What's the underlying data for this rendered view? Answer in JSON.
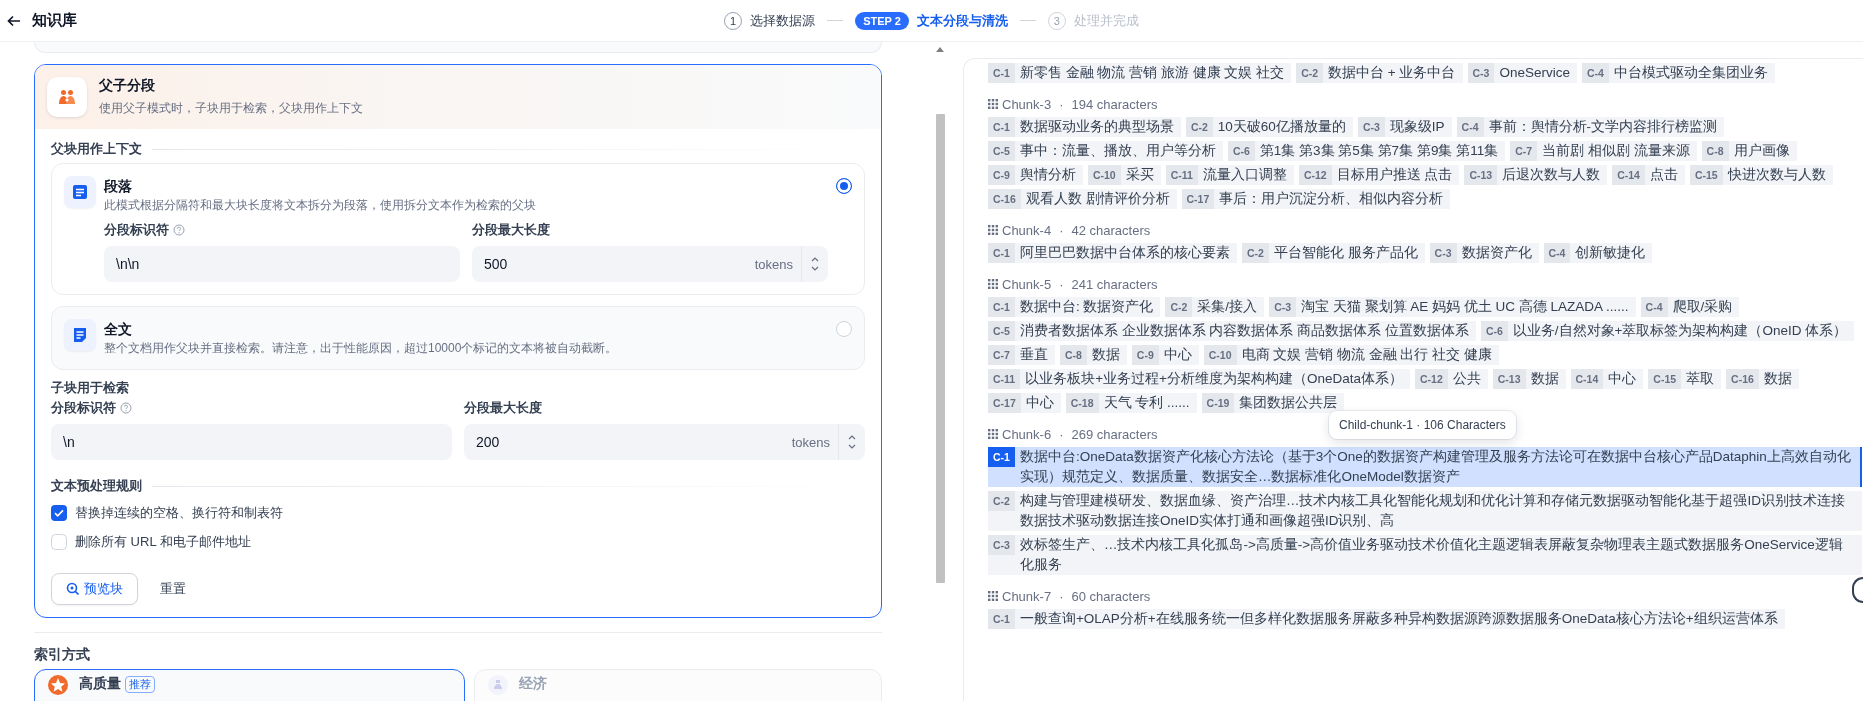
{
  "header": {
    "title": "知识库"
  },
  "steps": [
    {
      "badge": "1",
      "label": "选择数据源",
      "done": true,
      "selected": false
    },
    {
      "badge": "STEP 2",
      "label": "文本分段与清洗",
      "selected": true
    },
    {
      "badge": "3",
      "label": "处理并完成",
      "done": false,
      "selected": false
    }
  ],
  "left": {
    "mode": {
      "title": "父子分段",
      "description": "使用父子模式时，子块用于检索，父块用作上下文",
      "selected": true
    },
    "parent_section": {
      "title": "父块用作上下文",
      "options": [
        {
          "title": "段落",
          "description": "此模式根据分隔符和最大块长度将文本拆分为段落，使用拆分文本作为检索的父块",
          "selected": true,
          "fields": [
            {
              "kind": "separator",
              "label": "分段标识符",
              "value": "\\n\\n"
            },
            {
              "kind": "length",
              "label": "分段最大长度",
              "value": "500",
              "unit": "tokens"
            }
          ]
        },
        {
          "title": "全文",
          "description": "整个文档用作父块并直接检索。请注意，出于性能原因，超过10000个标记的文本将被自动截断。",
          "selected": false
        }
      ]
    },
    "child_section": {
      "title": "子块用于检索",
      "fields": [
        {
          "kind": "separator",
          "label": "分段标识符",
          "value": "\\n"
        },
        {
          "kind": "length",
          "label": "分段最大长度",
          "value": "200",
          "unit": "tokens"
        }
      ]
    },
    "preprocessing": {
      "title": "文本预处理规则",
      "rules": [
        {
          "label": "替换掉连续的空格、换行符和制表符",
          "checked": true
        },
        {
          "label": "删除所有 URL 和电子邮件地址",
          "checked": false
        }
      ]
    },
    "actions": [
      {
        "kind": "preview",
        "label": "预览块"
      },
      {
        "kind": "reset",
        "label": "重置"
      }
    ],
    "index_section": {
      "title": "索引方式",
      "options": [
        {
          "kind": "quality",
          "title": "高质量",
          "badge": "推荐",
          "selected": true
        },
        {
          "kind": "economy",
          "title": "经济",
          "selected": false
        }
      ]
    }
  },
  "right": {
    "chunks": [
      {
        "segments": [
          {
            "tag": "C-1",
            "text": "新零售 金融 物流 营销 旅游 健康 文娱 社交",
            "selected": false
          },
          {
            "tag": "C-2",
            "text": "数据中台 + 业务中台",
            "selected": false
          },
          {
            "tag": "C-3",
            "text": "OneService",
            "selected": false
          },
          {
            "tag": "C-4",
            "text": "中台模式驱动全集团业务",
            "selected": false
          }
        ]
      },
      {
        "name": "Chunk-3",
        "dot": "·",
        "size": "194 characters",
        "segments": [
          {
            "tag": "C-1",
            "text": "数据驱动业务的典型场景",
            "selected": false
          },
          {
            "tag": "C-2",
            "text": "10天破60亿播放量的",
            "selected": false
          },
          {
            "tag": "C-3",
            "text": "现象级IP",
            "selected": false
          },
          {
            "tag": "C-4",
            "text": "事前：舆情分析-文学内容排行榜监测",
            "selected": false
          },
          {
            "tag": "C-5",
            "text": "事中：流量、播放、用户等分析",
            "selected": false
          },
          {
            "tag": "C-6",
            "text": "第1集 第3集 第5集 第7集 第9集 第11集",
            "selected": false
          },
          {
            "tag": "C-7",
            "text": "当前剧 相似剧 流量来源",
            "selected": false
          },
          {
            "tag": "C-8",
            "text": "用户画像",
            "selected": false
          },
          {
            "tag": "C-9",
            "text": "舆情分析",
            "selected": false
          },
          {
            "tag": "C-10",
            "text": "采买",
            "selected": false
          },
          {
            "tag": "C-11",
            "text": "流量入口调整",
            "selected": false
          },
          {
            "tag": "C-12",
            "text": "目标用户推送 点击",
            "selected": false
          },
          {
            "tag": "C-13",
            "text": "后退次数与人数",
            "selected": false
          },
          {
            "tag": "C-14",
            "text": "点击",
            "selected": false
          },
          {
            "tag": "C-15",
            "text": "快进次数与人数",
            "selected": false
          },
          {
            "tag": "C-16",
            "text": "观看人数 剧情评价分析",
            "selected": false
          },
          {
            "tag": "C-17",
            "text": "事后：用户沉淀分析、相似内容分析",
            "selected": false
          }
        ]
      },
      {
        "name": "Chunk-4",
        "dot": "·",
        "size": "42 characters",
        "segments": [
          {
            "tag": "C-1",
            "text": "阿里巴巴数据中台体系的核心要素",
            "selected": false
          },
          {
            "tag": "C-2",
            "text": "平台智能化 服务产品化",
            "selected": false
          },
          {
            "tag": "C-3",
            "text": "数据资产化",
            "selected": false
          },
          {
            "tag": "C-4",
            "text": "创新敏捷化",
            "selected": false
          }
        ]
      },
      {
        "name": "Chunk-5",
        "dot": "·",
        "size": "241 characters",
        "segments": [
          {
            "tag": "C-1",
            "text": "数据中台: 数据资产化",
            "selected": false
          },
          {
            "tag": "C-2",
            "text": "采集/接入",
            "selected": false
          },
          {
            "tag": "C-3",
            "text": "淘宝 天猫 聚划算 AE 妈妈 优土 UC 高德 LAZADA ......",
            "selected": false
          },
          {
            "tag": "C-4",
            "text": "爬取/采购",
            "selected": false
          },
          {
            "tag": "C-5",
            "text": "消费者数据体系 企业数据体系 内容数据体系 商品数据体系 位置数据体系",
            "selected": false
          },
          {
            "tag": "C-6",
            "text": "以业务/自然对象+萃取标签为架构构建（OneID 体系）",
            "selected": false
          },
          {
            "tag": "C-7",
            "text": "垂直",
            "selected": false
          },
          {
            "tag": "C-8",
            "text": "数据",
            "selected": false
          },
          {
            "tag": "C-9",
            "text": "中心",
            "selected": false
          },
          {
            "tag": "C-10",
            "text": "电商 文娱 营销 物流 金融 出行 社交 健康",
            "selected": false
          },
          {
            "tag": "C-11",
            "text": "以业务板块+业务过程+分析维度为架构构建（OneData体系）",
            "selected": false
          },
          {
            "tag": "C-12",
            "text": "公共",
            "selected": false
          },
          {
            "tag": "C-13",
            "text": "数据",
            "selected": false
          },
          {
            "tag": "C-14",
            "text": "中心",
            "selected": false
          },
          {
            "tag": "C-15",
            "text": "萃取",
            "selected": false
          },
          {
            "tag": "C-16",
            "text": "数据",
            "selected": false
          },
          {
            "tag": "C-17",
            "text": "中心",
            "selected": false
          },
          {
            "tag": "C-18",
            "text": "天气 专利 ......",
            "selected": false
          },
          {
            "tag": "C-19",
            "text": "集团数据公共层",
            "selected": false
          }
        ]
      },
      {
        "name": "Chunk-6",
        "dot": "·",
        "size": "269 characters",
        "tooltip": "Child-chunk-1 · 106 Characters",
        "segments": [
          {
            "tag": "C-1",
            "text": "数据中台:OneData数据资产化核心方法论（基于3个One的数据资产构建管理及服务方法论可在数据中台核心产品Dataphin上高效自动化实现）规范定义、数据质量、数据安全…数据标准化OneModel数据资产",
            "selected": true
          },
          {
            "tag": "C-2",
            "text": "构建与管理建模研发、数据血缘、资产治理…技术内核工具化智能化规划和优化计算和存储元数据驱动智能化基于超强ID识别技术连接数据技术驱动数据连接OneID实体打通和画像超强ID识别、高",
            "selected": false
          },
          {
            "tag": "C-3",
            "text": "效标签生产、…技术内核工具化孤岛->高质量->高价值业务驱动技术价值化主题逻辑表屏蔽复杂物理表主题式数据服务OneService逻辑化服务",
            "selected": false
          }
        ]
      },
      {
        "name": "Chunk-7",
        "dot": "·",
        "size": "60 characters",
        "segments": [
          {
            "tag": "C-1",
            "text": "一般查询+OLAP分析+在线服务统一但多样化数据服务屏蔽多种异构数据源跨源数据服务OneData核心方法论+组织运营体系",
            "selected": false
          }
        ]
      }
    ]
  }
}
